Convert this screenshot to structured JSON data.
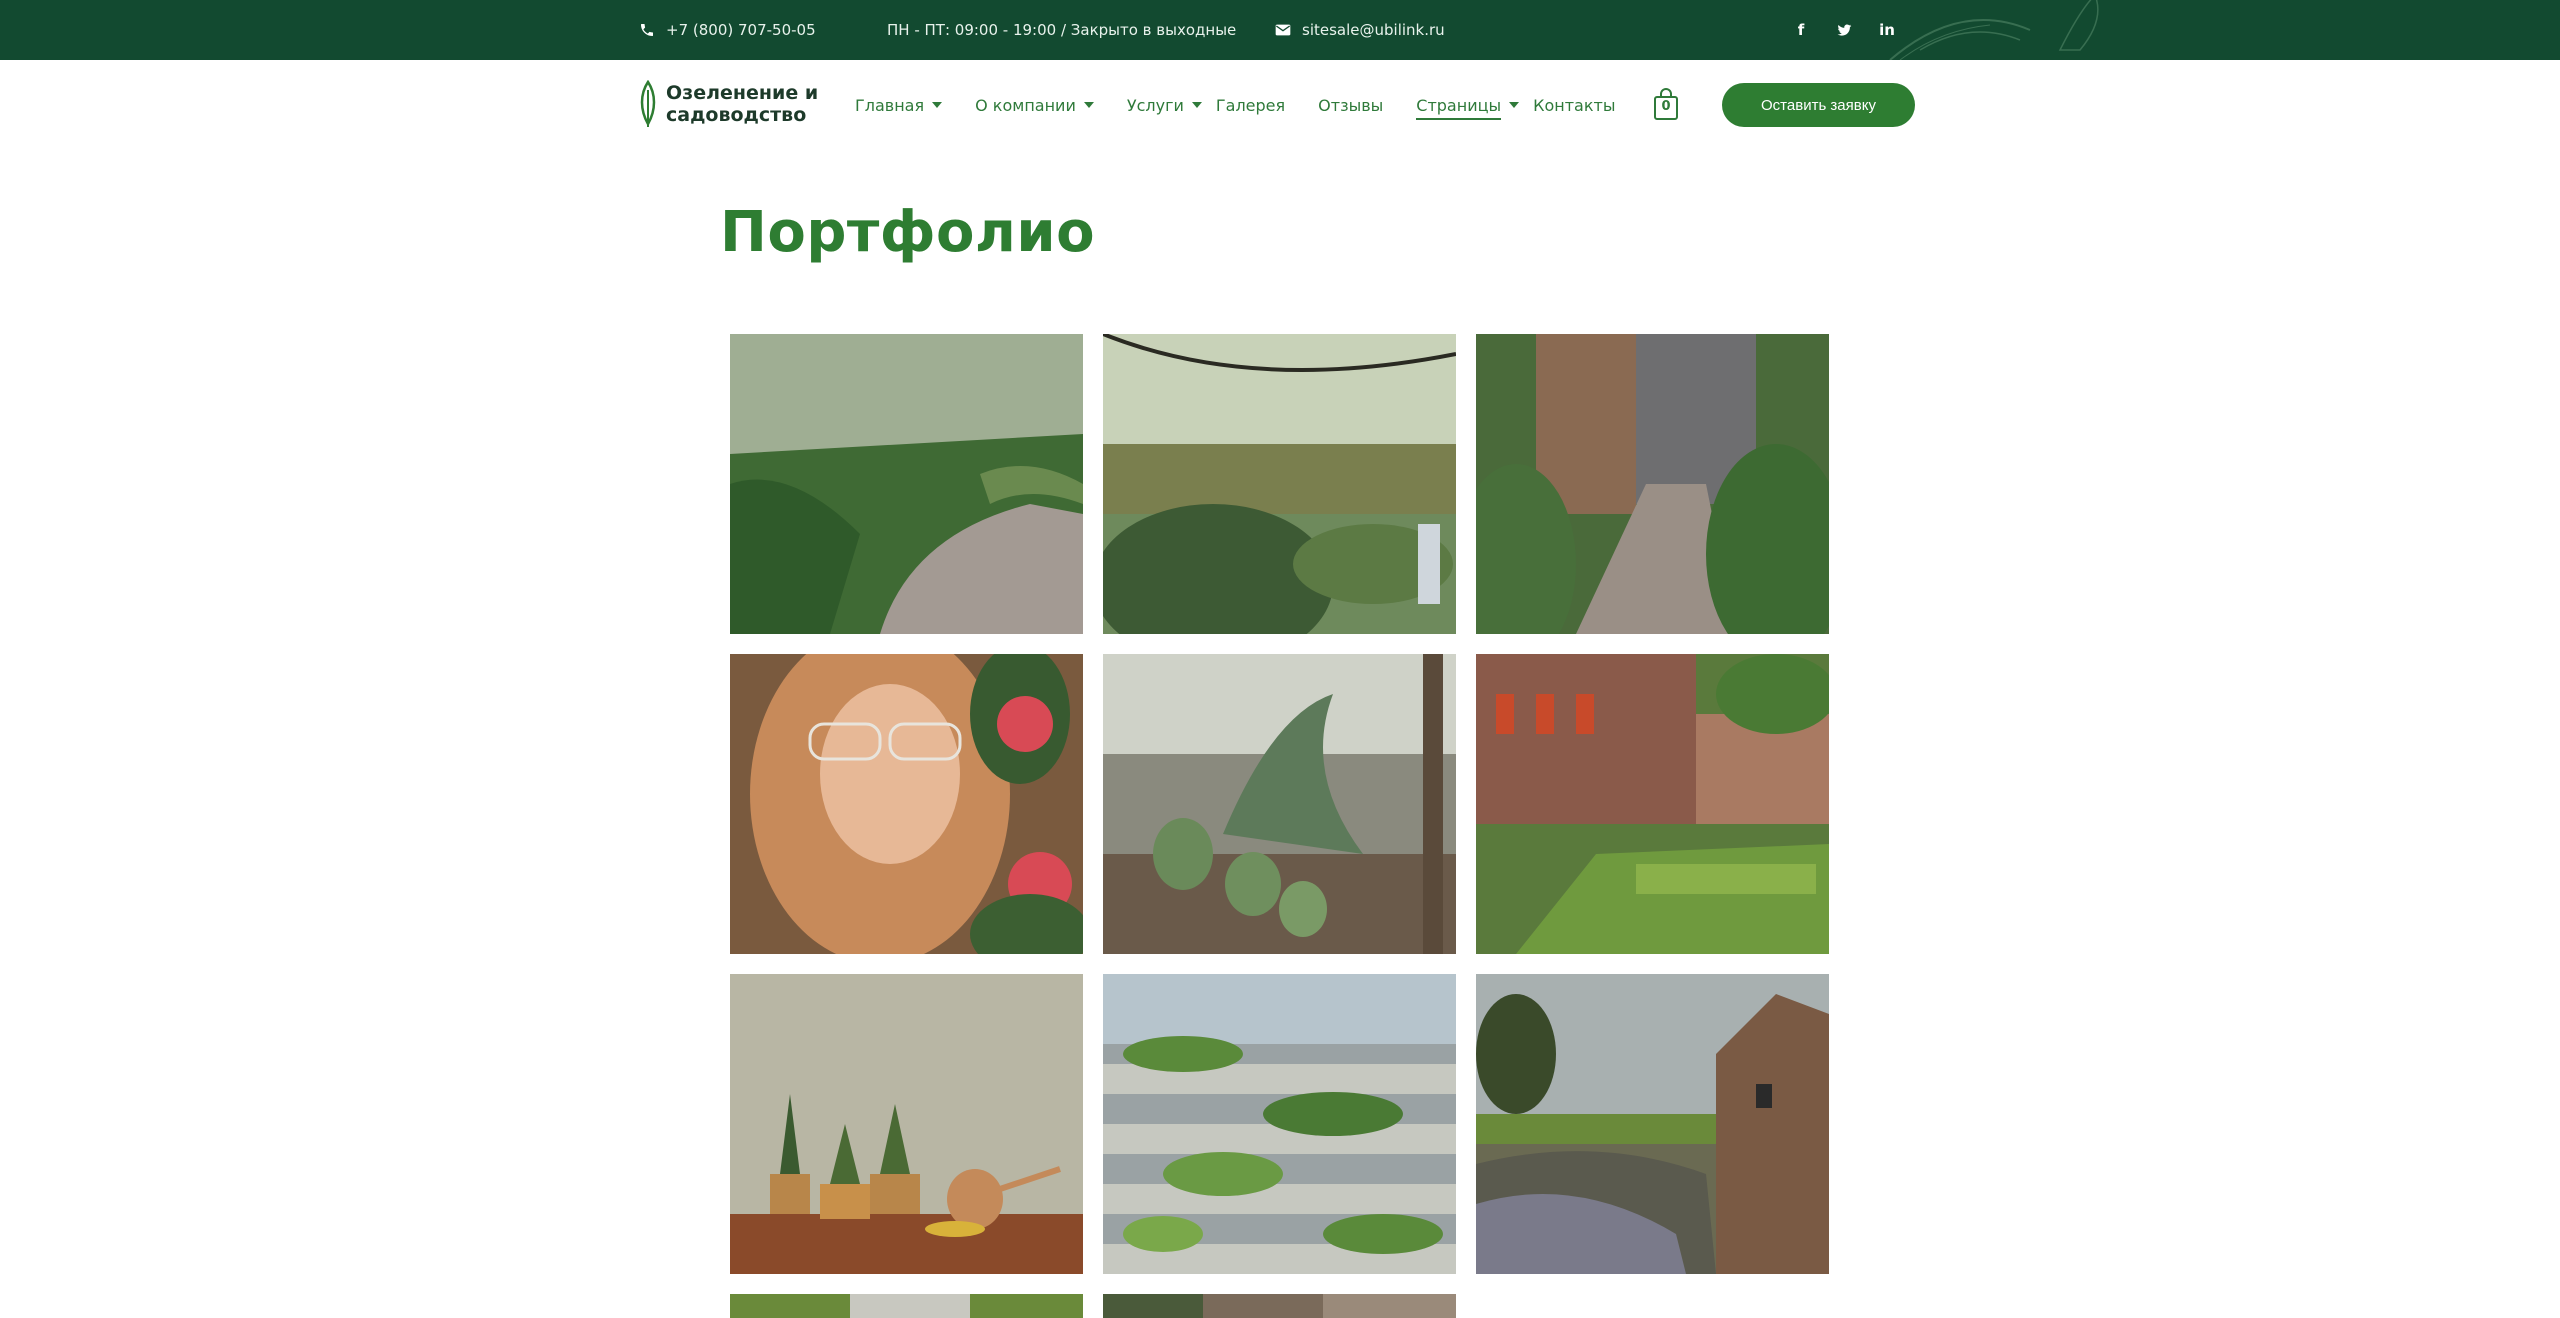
{
  "topbar": {
    "phone": "+7 (800) 707-50-05",
    "hours": "ПН - ПТ: 09:00 - 19:00 / Закрыто в выходные",
    "email": "sitesale@ubilink.ru",
    "social": {
      "facebook": "f",
      "twitter": "t",
      "linkedin": "in"
    }
  },
  "header": {
    "logo_text": "Озеленение и садоводство",
    "nav": [
      {
        "label": "Главная"
      },
      {
        "label": "О компании"
      },
      {
        "label": "Услуги"
      },
      {
        "label": "Галерея"
      },
      {
        "label": "Отзывы"
      },
      {
        "label": "Страницы"
      },
      {
        "label": "Контакты"
      }
    ],
    "cart_count": "0",
    "cta_label": "Оставить заявку"
  },
  "page": {
    "title": "Портфолио"
  },
  "colors": {
    "topbar_bg": "#124a30",
    "accent": "#2e7d32",
    "nav_text": "#2f7a3a"
  },
  "icons": {
    "phone": "phone-icon",
    "email": "mail-icon",
    "cart": "shopping-bag-icon",
    "logo": "leaf-icon"
  }
}
